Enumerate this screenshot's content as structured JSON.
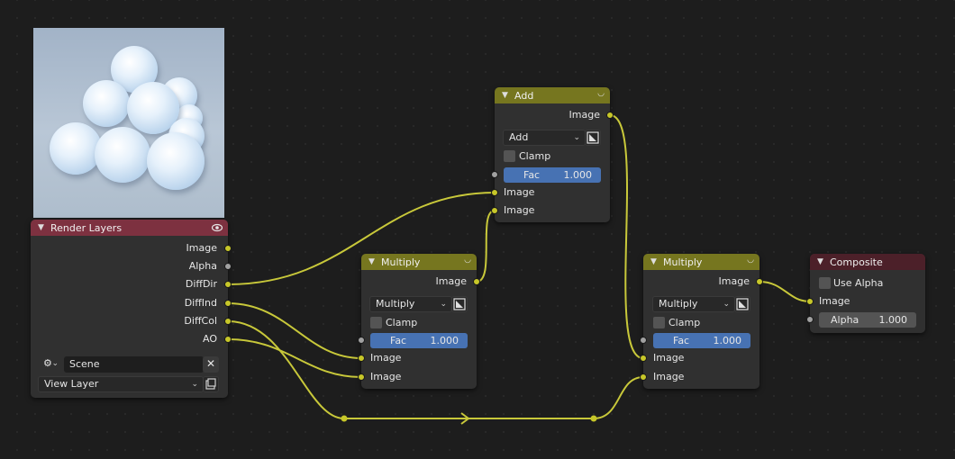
{
  "colors": {
    "wire": "#c8c83a",
    "socket_color": "#c7c729",
    "socket_value": "#a1a1a1",
    "mix_header": "#76761f",
    "render_layers_header": "#7d3140",
    "composite_header": "#4c2029",
    "fac_slider": "#4772b3",
    "node_body": "#303030",
    "background": "#1d1d1d"
  },
  "render_layers": {
    "title": "Render Layers",
    "header_icon": "eye-icon",
    "outputs": [
      "Image",
      "Alpha",
      "DiffDir",
      "DiffInd",
      "DiffCol",
      "AO"
    ],
    "scene": "Scene",
    "view_layer": "View Layer"
  },
  "add_node": {
    "title": "Add",
    "output": "Image",
    "blend_mode": "Add",
    "clamp_label": "Clamp",
    "fac_label": "Fac",
    "fac_value": "1.000",
    "inputs": [
      "Image",
      "Image"
    ]
  },
  "multiply_node_1": {
    "title": "Multiply",
    "output": "Image",
    "blend_mode": "Multiply",
    "clamp_label": "Clamp",
    "fac_label": "Fac",
    "fac_value": "1.000",
    "inputs": [
      "Image",
      "Image"
    ]
  },
  "multiply_node_2": {
    "title": "Multiply",
    "output": "Image",
    "blend_mode": "Multiply",
    "clamp_label": "Clamp",
    "fac_label": "Fac",
    "fac_value": "1.000",
    "inputs": [
      "Image",
      "Image"
    ]
  },
  "composite_node": {
    "title": "Composite",
    "use_alpha_label": "Use Alpha",
    "input": "Image",
    "alpha_label": "Alpha",
    "alpha_value": "1.000"
  }
}
